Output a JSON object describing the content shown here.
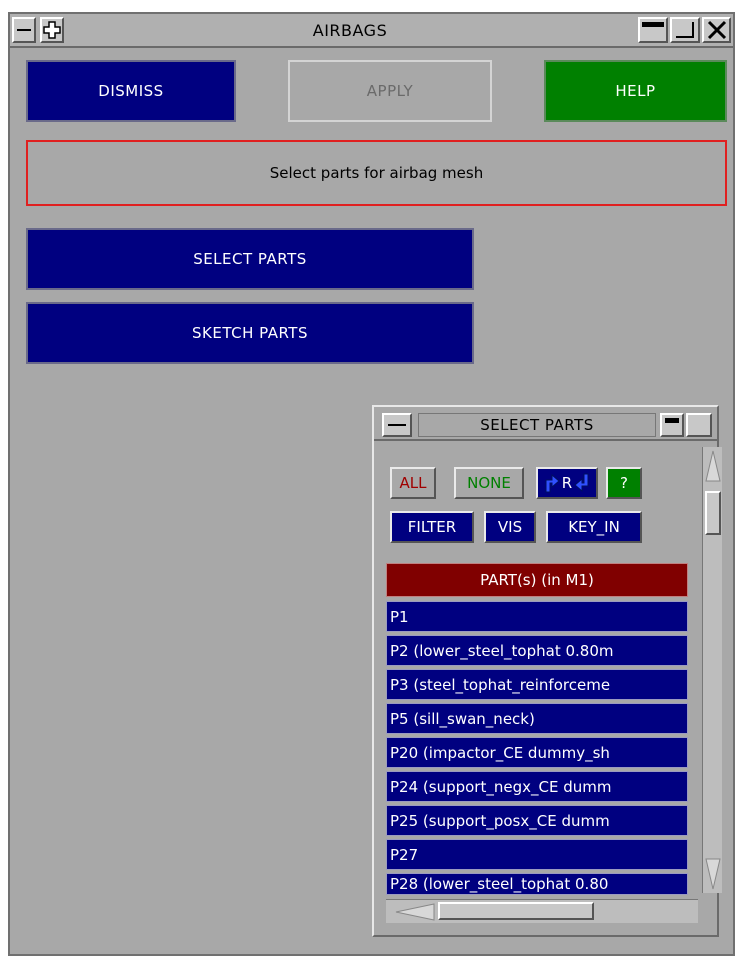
{
  "window": {
    "title": "AIRBAGS"
  },
  "buttons": {
    "dismiss": "DISMISS",
    "apply": "APPLY",
    "help": "HELP"
  },
  "message": "Select parts for airbag mesh",
  "actions": {
    "select_parts": "SELECT PARTS",
    "sketch_parts": "SKETCH PARTS"
  },
  "select_panel": {
    "title": "SELECT PARTS",
    "all": "ALL",
    "none": "NONE",
    "pr_letter": "R",
    "help": "?",
    "filter": "FILTER",
    "vis": "VIS",
    "key_in": "KEY_IN",
    "list_header": "PART(s) (in M1)",
    "items": [
      "P1",
      "P2 (lower_steel_tophat 0.80m",
      "P3 (steel_tophat_reinforceme",
      "P5 (sill_swan_neck)",
      "P20 (impactor_CE dummy_sh",
      "P24 (support_negx_CE dumm",
      "P25 (support_posx_CE dumm",
      "P27",
      "P28 (lower_steel_tophat 0.80"
    ]
  },
  "colors": {
    "navy": "#000080",
    "green": "#008000",
    "header_red": "#800000",
    "panel_grey": "#a8a8a8",
    "message_border": "#e02020"
  }
}
